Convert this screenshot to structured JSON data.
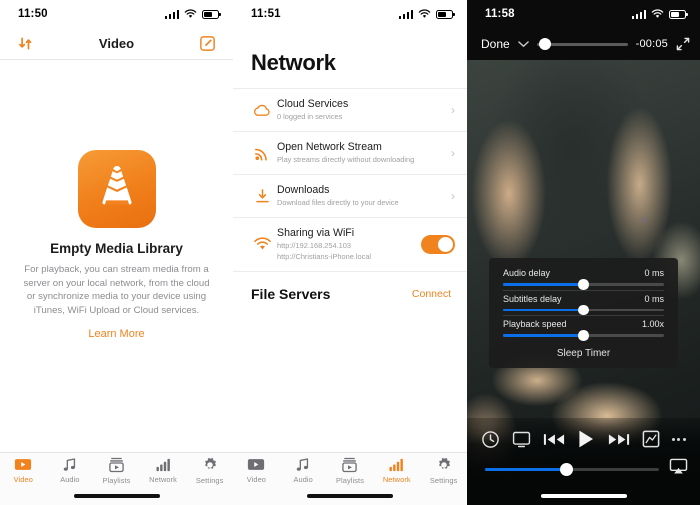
{
  "accent": "#f0831e",
  "slider_blue": "#0a6fe8",
  "panel_video": {
    "status": {
      "time": "11:50",
      "signal_icon": "cellular-bars-icon",
      "wifi_icon": "wifi-icon",
      "battery_icon": "battery-icon"
    },
    "navbar": {
      "sort_icon": "sort-icon",
      "title": "Video",
      "edit_icon": "edit-compose-icon"
    },
    "empty": {
      "logo_icon": "vlc-cone-logo-icon",
      "title": "Empty Media Library",
      "description": "For playback, you can stream media from a server on your local network, from the cloud or synchronize media to your device using iTunes, WiFi Upload or Cloud services.",
      "link": "Learn More"
    },
    "tabs": [
      {
        "label": "Video",
        "icon": "video-icon",
        "active": true
      },
      {
        "label": "Audio",
        "icon": "music-note-icon",
        "active": false
      },
      {
        "label": "Playlists",
        "icon": "playlists-icon",
        "active": false
      },
      {
        "label": "Network",
        "icon": "network-bars-icon",
        "active": false
      },
      {
        "label": "Settings",
        "icon": "gear-icon",
        "active": false
      }
    ]
  },
  "panel_network": {
    "status": {
      "time": "11:51",
      "signal_icon": "cellular-bars-icon",
      "wifi_icon": "wifi-icon",
      "battery_icon": "battery-icon"
    },
    "title": "Network",
    "rows": [
      {
        "title": "Cloud Services",
        "subtitle": "0 logged in services",
        "icon": "cloud-icon",
        "accessory": "chevron"
      },
      {
        "title": "Open Network Stream",
        "subtitle": "Play streams directly without downloading",
        "icon": "broadcast-stream-icon",
        "accessory": "chevron"
      },
      {
        "title": "Downloads",
        "subtitle": "Download files directly to your device",
        "icon": "download-icon",
        "accessory": "chevron"
      },
      {
        "title": "Sharing via WiFi",
        "subtitle": "http://192.168.254.103",
        "subtitle2": "http://Christians-iPhone.local",
        "icon": "wifi-share-icon",
        "accessory": "toggle",
        "toggle_on": true
      }
    ],
    "file_servers": {
      "title": "File Servers",
      "action": "Connect"
    },
    "tabs": [
      {
        "label": "Video",
        "icon": "video-icon",
        "active": false
      },
      {
        "label": "Audio",
        "icon": "music-note-icon",
        "active": false
      },
      {
        "label": "Playlists",
        "icon": "playlists-icon",
        "active": false
      },
      {
        "label": "Network",
        "icon": "network-bars-icon",
        "active": true
      },
      {
        "label": "Settings",
        "icon": "gear-icon",
        "active": false
      }
    ]
  },
  "panel_player": {
    "status": {
      "time": "11:58",
      "signal_icon": "cellular-bars-icon",
      "wifi_icon": "wifi-icon",
      "battery_icon": "battery-icon"
    },
    "topbar": {
      "done_label": "Done",
      "chevron_icon": "chevron-down-icon",
      "remaining_time": "-00:05",
      "expand_icon": "expand-fullscreen-icon"
    },
    "settings_popup": {
      "sliders": [
        {
          "label": "Audio delay",
          "value": "0 ms"
        },
        {
          "label": "Subtitles delay",
          "value": "0 ms"
        },
        {
          "label": "Playback speed",
          "value": "1.00x"
        }
      ],
      "sleep_timer": "Sleep Timer"
    },
    "controls": [
      {
        "icon": "clock-icon"
      },
      {
        "icon": "aspect-ratio-screen-icon"
      },
      {
        "icon": "previous-track-icon"
      },
      {
        "icon": "play-icon"
      },
      {
        "icon": "next-track-icon"
      },
      {
        "icon": "video-equalizer-icon"
      },
      {
        "icon": "more-options-icon"
      }
    ],
    "volume": {
      "icon": "airplay-icon"
    }
  }
}
